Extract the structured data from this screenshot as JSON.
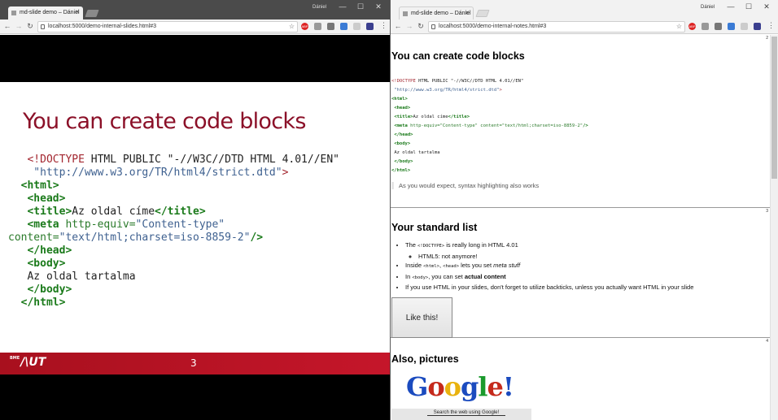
{
  "left_window": {
    "tab_title": "md-slide demo – Dániel",
    "user": "Dániel",
    "url": "localhost:5000/demo-internal-slides.html#3",
    "slide": {
      "title": "You can create code blocks",
      "footer_logo": "/\\UT",
      "footer_logo_prefix": "BME",
      "slide_number": "3"
    }
  },
  "right_window": {
    "tab_title": "md-slide demo – Dániel",
    "user": "Dániel",
    "url": "localhost:5000/demo-internal-notes.html#3",
    "notes": [
      {
        "number": "2",
        "title": "You can create code blocks",
        "blockquote": "As you would expect, syntax highlighting also works"
      },
      {
        "number": "3",
        "title": "Your standard list",
        "items": {
          "i1_a": "The ",
          "i1_code": "<!DOCTYPE>",
          "i1_b": " is really long in HTML 4.01",
          "i1_sub": "HTML5: not anymore!",
          "i2_a": "Inside ",
          "i2_code1": "<html>",
          "i2_sep": ", ",
          "i2_code2": "<head>",
          "i2_b": " lets you set ",
          "i2_em": "meta stuff",
          "i3_a": "In ",
          "i3_code": "<body>",
          "i3_b": ", you can set ",
          "i3_strong": "actual content",
          "i4": "If you use HTML in your slides, don't forget to utilize backticks, unless you actually want HTML in your slide"
        },
        "button": "Like this!"
      },
      {
        "number": "4",
        "title": "Also, pictures",
        "google_logo": "Google!",
        "search_caption": "Search the web using Google!"
      }
    ]
  },
  "code": {
    "l1a": "<!DOCTYPE",
    "l1b": " HTML PUBLIC \"-//W3C//DTD HTML 4.01//EN\"",
    "l2a": " \"http://www.w3.org/TR/html4/strict.dtd\"",
    "l2b": ">",
    "l3": "<html>",
    "l4": "<head>",
    "l5a": "<title>",
    "l5b": "Az oldal címe",
    "l5c": "</title>",
    "l6a": "<meta",
    "l6b": " http-equiv=",
    "l6c": "\"Content-type\"",
    "l7a": "content=",
    "l7b": "\"text/html;charset=iso-8859-2\"",
    "l7c": "/>",
    "l8": "</head>",
    "l9": "<body>",
    "l10": "Az oldal tartalma",
    "l11": "</body>",
    "l12": "</html>",
    "small_l6": " http-equiv=\"Content-type\" content=\"text/html;charset=iso-8859-2\"",
    "small_l6b": "/>"
  },
  "colors": {
    "slide_title": "#8b1028",
    "footer": "#c5162a",
    "tag": "#1a7a1a",
    "string": "#3f6190",
    "doctype": "#a3262f"
  }
}
